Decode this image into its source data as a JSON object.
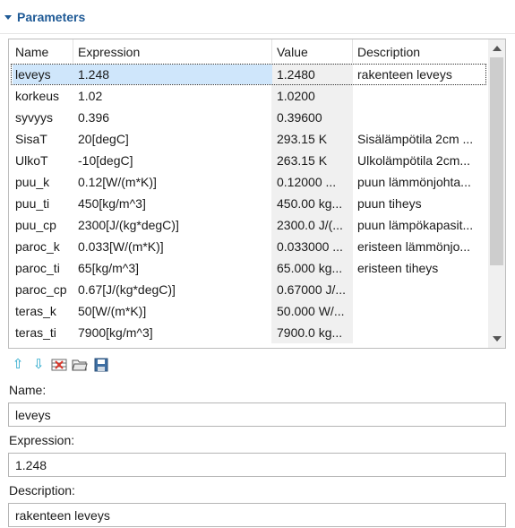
{
  "section": {
    "title": "Parameters"
  },
  "table": {
    "columns": [
      "Name",
      "Expression",
      "Value",
      "Description"
    ],
    "rows": [
      {
        "name": "leveys",
        "expression": "1.248",
        "value": "1.2480",
        "description": "rakenteen leveys"
      },
      {
        "name": "korkeus",
        "expression": "1.02",
        "value": "1.0200",
        "description": ""
      },
      {
        "name": "syvyys",
        "expression": "0.396",
        "value": "0.39600",
        "description": ""
      },
      {
        "name": "SisaT",
        "expression": "20[degC]",
        "value": "293.15 K",
        "description": "Sisälämpötila 2cm ..."
      },
      {
        "name": "UlkoT",
        "expression": "-10[degC]",
        "value": "263.15 K",
        "description": "Ulkolämpötila 2cm..."
      },
      {
        "name": "puu_k",
        "expression": "0.12[W/(m*K)]",
        "value": "0.12000 ...",
        "description": "puun lämmönjohta..."
      },
      {
        "name": "puu_ti",
        "expression": "450[kg/m^3]",
        "value": "450.00 kg...",
        "description": "puun tiheys"
      },
      {
        "name": "puu_cp",
        "expression": "2300[J/(kg*degC)]",
        "value": "2300.0 J/(...",
        "description": "puun lämpökapasit..."
      },
      {
        "name": "paroc_k",
        "expression": "0.033[W/(m*K)]",
        "value": "0.033000 ...",
        "description": "eristeen lämmönjo..."
      },
      {
        "name": "paroc_ti",
        "expression": "65[kg/m^3]",
        "value": "65.000 kg...",
        "description": "eristeen tiheys"
      },
      {
        "name": "paroc_cp",
        "expression": "0.67[J/(kg*degC)]",
        "value": "0.67000 J/...",
        "description": ""
      },
      {
        "name": "teras_k",
        "expression": "50[W/(m*K)]",
        "value": "50.000 W/...",
        "description": ""
      },
      {
        "name": "teras_ti",
        "expression": "7900[kg/m^3]",
        "value": "7900.0 kg...",
        "description": ""
      }
    ],
    "selected_row": 0
  },
  "toolbar": {
    "icons": [
      "move-up-icon",
      "move-down-icon",
      "clear-table-icon",
      "load-from-file-icon",
      "save-to-file-icon"
    ]
  },
  "form": {
    "name_label": "Name:",
    "name_value": "leveys",
    "expression_label": "Expression:",
    "expression_value": "1.248",
    "description_label": "Description:",
    "description_value": "rakenteen leveys"
  }
}
